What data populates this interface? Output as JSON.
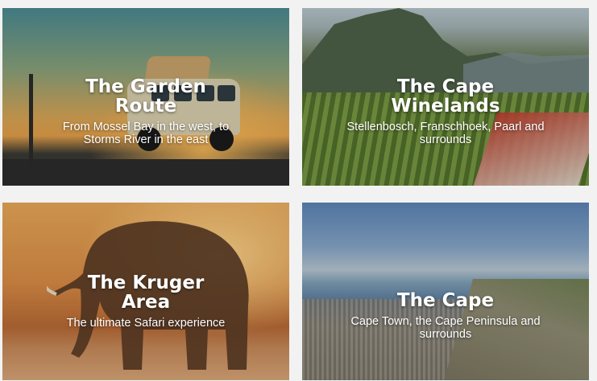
{
  "cards": [
    {
      "title": "The Garden Route",
      "subtitle": "From Mossel Bay in the west, to Storms River in the east"
    },
    {
      "title": "The Cape Winelands",
      "subtitle": "Stellenbosch, Franschhoek, Paarl and surrounds"
    },
    {
      "title": "The Kruger Area",
      "subtitle": "The ultimate Safari experience"
    },
    {
      "title": "The Cape",
      "subtitle": "Cape Town, the Cape Peninsula and surrounds"
    }
  ]
}
